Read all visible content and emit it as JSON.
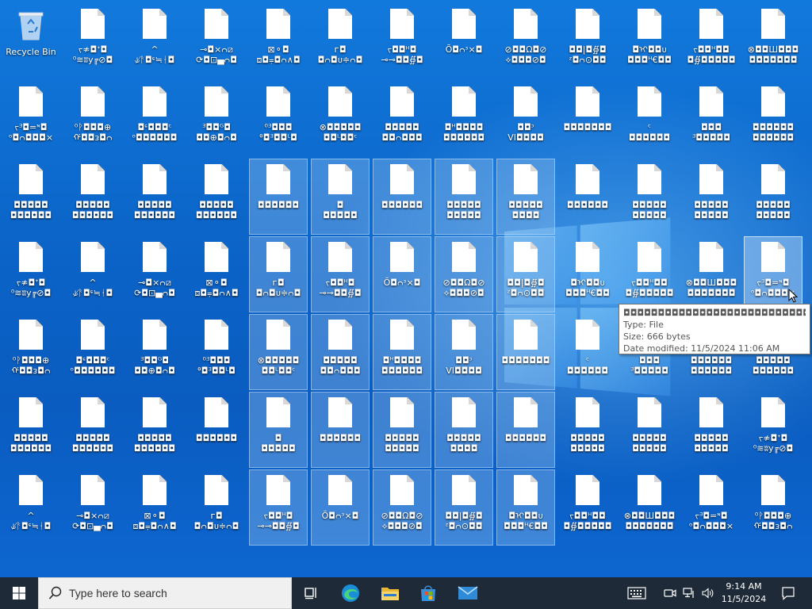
{
  "desktop": {
    "recycle_bin_label": "Recycle Bin",
    "icons": [
      {
        "label": "ᡪ≉◘ᐩ◘\n⁰≋ʬy╔⊘◘",
        "sel": false
      },
      {
        "label": "^\n⫝̸ᚨ◘ᶝ≒ᚽ◘",
        "sel": false
      },
      {
        "label": "⊸◘×ᴒ⧄\n⟳◘⊡▄ᴒ◘",
        "sel": false
      },
      {
        "label": "⊠⚬◘\n⧈◘⩦◘ᴒ∧◘",
        "sel": false
      },
      {
        "label": "᠌ᴦ◘\n◘ᴒ◘ᴜ≑ᴒ◘",
        "sel": false
      },
      {
        "label": "ᡪ◘◘ᴴ◘\n⊸⊸◘◘∯◘",
        "sel": false
      },
      {
        "label": "Ō◘ᴒᶟ×◘",
        "sel": false
      },
      {
        "label": "⊘◘◘Ω◘⊘\n⟡◘◘◘⊘◘",
        "sel": false
      },
      {
        "label": "◘◘|◘∯◘\nᶻ◘ᴒ⊙◘◘",
        "sel": false
      },
      {
        "label": "◘ᡳ◘◘ᴜ\n◘◘◘ᴴ€◘◘",
        "sel": false
      },
      {
        "label": "ᡪ◘◘ᴴ◘◘\n◘∯◘◘◘◘◘",
        "sel": false
      },
      {
        "label": "⊗◘◘Ш◘◘◘\n◘◘◘◘◘◘◘",
        "sel": false
      },
      {
        "label": "ᡪᴲ◘=ᶰ◘\nᵒ◘ᴒ◘◘◘×",
        "sel": false
      },
      {
        "label": "⁰ᚹ◘◘◘⊕\nᡤ◘◘ᴈ◘ᴒ",
        "sel": false
      },
      {
        "label": "◘ᶝ◘◘◘ᶜ\nᵒ◘◘◘◘◘◘",
        "sel": false
      },
      {
        "label": "ᴲ◘◘ᴳ◘\n◘◘⊕◘ᴒ◘",
        "sel": false
      },
      {
        "label": "⁰ᴲ◘◘◘\nᶿ◘ᴲ◘◘ᴸ◘",
        "sel": false
      },
      {
        "label": "⊗◘◘◘◘◘\n◘◘ᴸ◘◘ᶜ",
        "sel": false
      },
      {
        "label": "◘◘◘◘◘\n◘◘ᴒ◘◘◘",
        "sel": false
      },
      {
        "label": "◘ᴴ◘◘◘◘\n◘◘◘◘◘◘",
        "sel": false
      },
      {
        "label": "◘◘ᵓ\nVI◘◘◘◘",
        "sel": false
      },
      {
        "label": "◘◘◘◘◘◘◘",
        "sel": false
      },
      {
        "label": "ᶜ\n◘◘◘◘◘◘",
        "sel": false
      },
      {
        "label": "◘◘◘\nᴲ◘◘◘◘◘",
        "sel": false
      },
      {
        "label": "◘◘◘◘◘◘\n◘◘◘◘◘◘",
        "sel": false
      },
      {
        "label": "◘◘◘◘◘\n◘◘◘◘◘◘",
        "sel": false
      },
      {
        "label": "◘◘◘◘◘\n◘◘◘◘◘◘",
        "sel": false
      },
      {
        "label": "◘◘◘◘◘\n◘◘◘◘◘◘",
        "sel": false
      },
      {
        "label": "◘◘◘◘◘\n◘◘◘◘◘◘",
        "sel": false
      },
      {
        "label": "◘◘◘◘◘◘",
        "sel": true
      },
      {
        "label": "◘\n◘◘◘◘◘",
        "sel": true
      },
      {
        "label": "◘◘◘◘◘◘",
        "sel": true
      },
      {
        "label": "◘◘◘◘◘\n◘◘◘◘◘",
        "sel": true
      },
      {
        "label": "◘◘◘◘◘\n◘◘◘◘",
        "sel": true
      },
      {
        "label": "◘◘◘◘◘◘",
        "sel": false
      },
      {
        "label": "◘◘◘◘◘\n◘◘◘◘◘",
        "sel": false
      },
      {
        "label": "◘◘◘◘◘\n◘◘◘◘◘",
        "sel": false
      },
      {
        "label": "◘◘◘◘◘\n◘◘◘◘◘",
        "sel": false
      }
    ]
  },
  "tooltip": {
    "name": "◘◘◘◘◘◘◘◘◘◘◘◘◘◘◘◘◘◘◘◘◘◘◘◘◘◘◘◘",
    "type": "Type: File",
    "size": "Size: 666 bytes",
    "modified": "Date modified: 11/5/2024 11:06 AM"
  },
  "taskbar": {
    "search_placeholder": "Type here to search",
    "time": "9:14 AM",
    "date": "11/5/2024",
    "apps": [
      "task-view-icon",
      "edge-icon",
      "file-explorer-icon",
      "store-icon",
      "mail-icon"
    ]
  },
  "colors": {
    "taskbar": "#1f2a38",
    "desktop": "#0a63c9",
    "accent": "#7fb6ee"
  }
}
